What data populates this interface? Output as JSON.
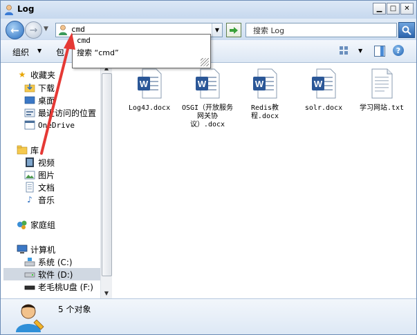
{
  "window": {
    "title": "Log"
  },
  "address": {
    "value": "cmd"
  },
  "search": {
    "placeholder": "搜索 Log"
  },
  "toolbar": {
    "organize": "组织",
    "include": "包"
  },
  "autocomplete": {
    "items": [
      "cmd",
      "搜索 “cmd”"
    ]
  },
  "nav": {
    "favorites": {
      "label": "收藏夹",
      "items": [
        "下载",
        "桌面",
        "最近访问的位置",
        "OneDrive"
      ]
    },
    "libraries": {
      "label": "库",
      "items": [
        "视频",
        "图片",
        "文档",
        "音乐"
      ]
    },
    "homegroup": {
      "label": "家庭组"
    },
    "computer": {
      "label": "计算机",
      "items": [
        "系统 (C:)",
        "软件 (D:)",
        "老毛桃U盘 (F:)"
      ]
    }
  },
  "files": [
    {
      "name": "Log4J.docx",
      "type": "word"
    },
    {
      "name": "OSGI（开放服务网关协议）.docx",
      "type": "word"
    },
    {
      "name": "Redis教程.docx",
      "type": "word"
    },
    {
      "name": "solr.docx",
      "type": "word"
    },
    {
      "name": "学习网站.txt",
      "type": "text"
    }
  ],
  "status": {
    "text": "5 个对象"
  },
  "colors": {
    "accent": "#2b5797",
    "annotation_arrow": "#e53935"
  }
}
